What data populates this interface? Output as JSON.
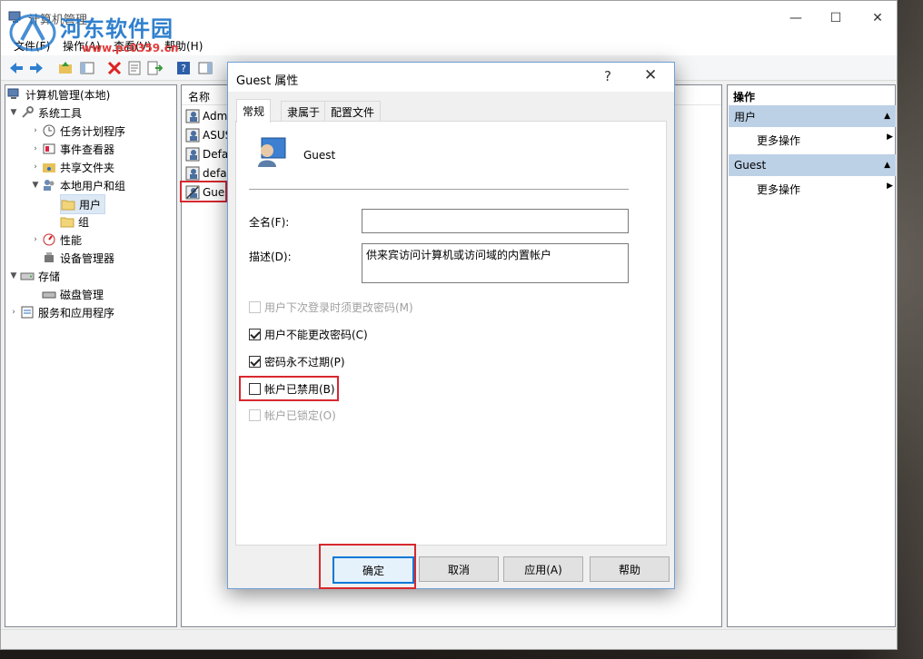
{
  "main_window": {
    "title": "计算机管理",
    "menu": [
      "文件(F)",
      "操作(A)",
      "查看(V)",
      "帮助(H)"
    ],
    "watermark": "河东软件园",
    "watermark_url": "www.pc0359.cn"
  },
  "tree": {
    "root": "计算机管理(本地)",
    "system_tools": "系统工具",
    "task_scheduler": "任务计划程序",
    "event_viewer": "事件查看器",
    "shared_folders": "共享文件夹",
    "local_users_groups": "本地用户和组",
    "users": "用户",
    "groups": "组",
    "performance": "性能",
    "device_manager": "设备管理器",
    "storage": "存储",
    "disk_management": "磁盘管理",
    "services_apps": "服务和应用程序"
  },
  "list": {
    "header_name": "名称",
    "rows": [
      "Admi",
      "ASUS",
      "Defa",
      "defau",
      "Gues"
    ]
  },
  "actions": {
    "header": "操作",
    "section1": "用户",
    "section1_more": "更多操作",
    "section2": "Guest",
    "section2_more": "更多操作"
  },
  "dialog": {
    "title": "Guest 属性",
    "help": "?",
    "close": "✕",
    "tabs": [
      "常规",
      "隶属于",
      "配置文件"
    ],
    "username": "Guest",
    "fullname_label": "全名(F):",
    "fullname_value": "",
    "desc_label": "描述(D):",
    "desc_value": "供来宾访问计算机或访问域的内置帐户",
    "checkboxes": [
      {
        "label": "用户下次登录时须更改密码(M)",
        "checked": false,
        "disabled": true
      },
      {
        "label": "用户不能更改密码(C)",
        "checked": true,
        "disabled": false
      },
      {
        "label": "密码永不过期(P)",
        "checked": true,
        "disabled": false
      },
      {
        "label": "帐户已禁用(B)",
        "checked": false,
        "disabled": false
      },
      {
        "label": "帐户已锁定(O)",
        "checked": false,
        "disabled": true
      }
    ],
    "buttons": {
      "ok": "确定",
      "cancel": "取消",
      "apply": "应用(A)",
      "help": "帮助"
    }
  },
  "colors": {
    "highlight_box": "#d7282f",
    "accent": "#0078d7"
  }
}
